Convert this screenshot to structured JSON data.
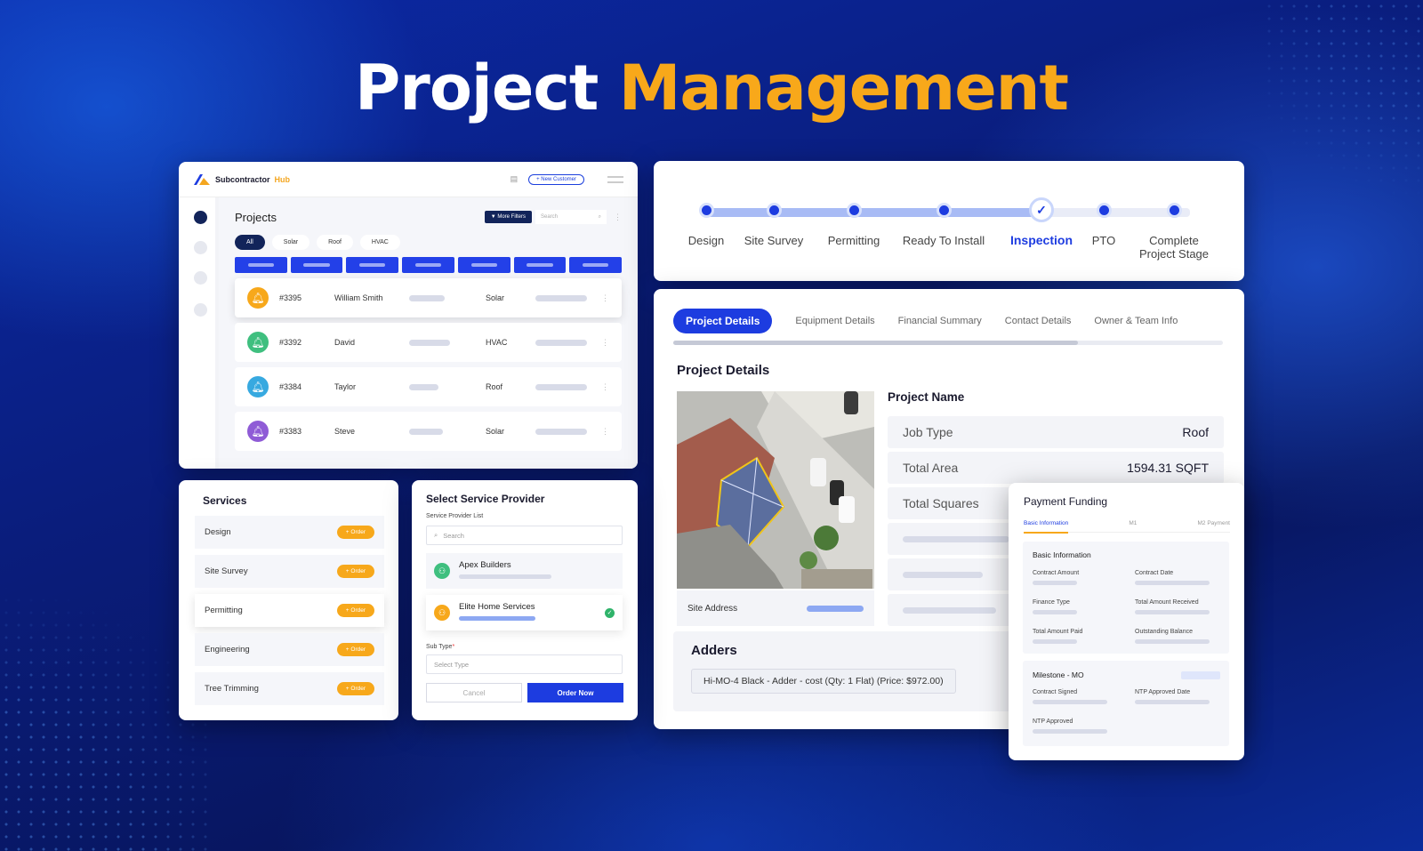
{
  "headline": {
    "part1": "Project",
    "part2": "Management",
    "accent_color": "#f8a81a"
  },
  "projects_card": {
    "logo": {
      "name": "Subcontractor",
      "suffix": "Hub"
    },
    "new_customer_button": "+ New Customer",
    "title": "Projects",
    "more_filters_button": "More Filters",
    "search_placeholder": "Search",
    "filters": [
      "All",
      "Solar",
      "Roof",
      "HVAC"
    ],
    "rows": [
      {
        "id": "#3395",
        "name": "William Smith",
        "type": "Solar",
        "color": "#f7a81b"
      },
      {
        "id": "#3392",
        "name": "David",
        "type": "HVAC",
        "color": "#3fbf7f"
      },
      {
        "id": "#3384",
        "name": "Taylor",
        "type": "Roof",
        "color": "#37a9e0"
      },
      {
        "id": "#3383",
        "name": "Steve",
        "type": "Solar",
        "color": "#8f5bd6"
      }
    ]
  },
  "stepper": {
    "steps": [
      "Design",
      "Site Survey",
      "Permitting",
      "Ready To Install",
      "Inspection",
      "PTO",
      "Complete Project Stage"
    ],
    "current_index": 4
  },
  "details_card": {
    "tabs": [
      "Project Details",
      "Equipment Details",
      "Financial Summary",
      "Contact Details",
      "Owner & Team Info"
    ],
    "active_tab": 0,
    "section_title": "Project Details",
    "project_name_label": "Project Name",
    "fields": [
      {
        "label": "Job Type",
        "value": "Roof"
      },
      {
        "label": "Total Area",
        "value": "1594.31 SQFT"
      },
      {
        "label": "Total Squares",
        "value": ""
      }
    ],
    "site_address_label": "Site Address",
    "adders_title": "Adders",
    "adder_item": "Hi-MO-4 Black - Adder - cost (Qty: 1 Flat) (Price: $972.00)"
  },
  "payment_card": {
    "title": "Payment Funding",
    "tabs": [
      "Basic Information",
      "M1",
      "M2 Payment"
    ],
    "basic_info_title": "Basic Information",
    "basic_labels": [
      "Contract Amount",
      "Contract Date",
      "Finance Type",
      "Total Amount Received",
      "Total Amount Paid",
      "Outstanding Balance"
    ],
    "milestone_title": "Milestone - MO",
    "milestone_labels": [
      "Contract Signed",
      "NTP Approved Date",
      "NTP Approved"
    ]
  },
  "services_card": {
    "title": "Services",
    "order_label": "+ Order",
    "items": [
      "Design",
      "Site Survey",
      "Permitting",
      "Engineering",
      "Tree Trimming"
    ],
    "highlighted_index": 2
  },
  "provider_card": {
    "title": "Select Service Provider",
    "list_label": "Service Provider List",
    "search_placeholder": "Search",
    "providers": [
      {
        "name": "Apex Builders",
        "color": "#3fbf7f",
        "selected": false
      },
      {
        "name": "Elite Home Services",
        "color": "#f7a81b",
        "selected": true
      }
    ],
    "subtype_label": "Sub Type",
    "subtype_placeholder": "Select Type",
    "cancel_button": "Cancel",
    "order_button": "Order Now"
  }
}
